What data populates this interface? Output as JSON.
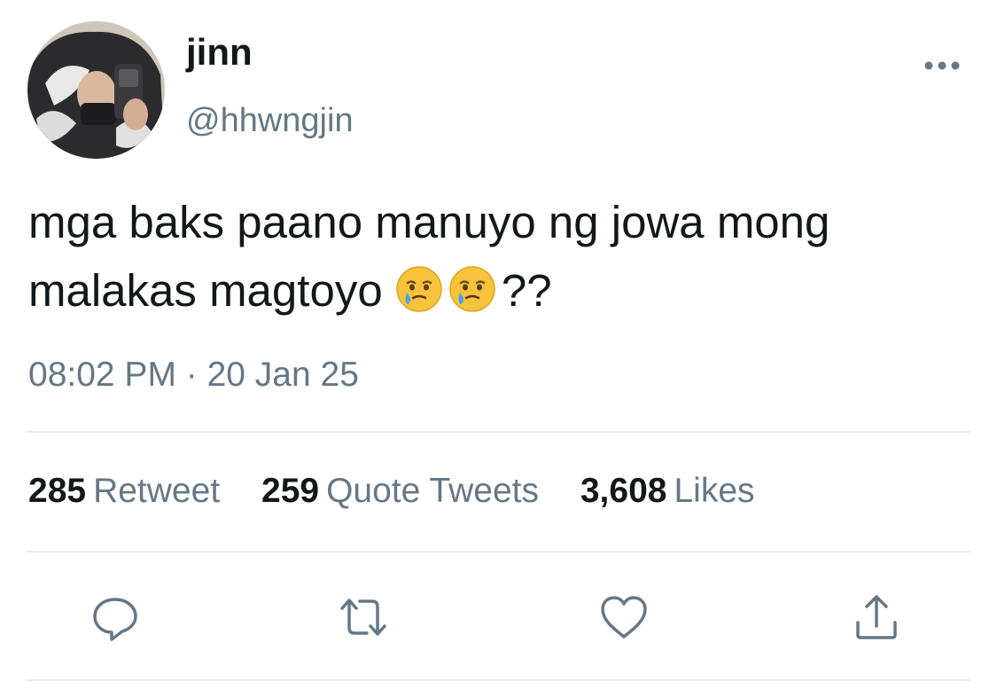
{
  "author": {
    "display_name": "jinn",
    "handle": "@hhwngjin"
  },
  "tweet": {
    "text_line1": "mga baks paano manuyo ng jowa mong",
    "text_line2": "malakas magtoyo",
    "text_suffix": "??",
    "emoji": [
      "face-holding-back-tears",
      "face-holding-back-tears"
    ],
    "timestamp": "08:02 PM · 20 Jan 25"
  },
  "stats": {
    "retweets": {
      "count": "285",
      "label": "Retweet"
    },
    "quotes": {
      "count": "259",
      "label": "Quote Tweets"
    },
    "likes": {
      "count": "3,608",
      "label": "Likes"
    }
  },
  "actions": [
    "reply-icon",
    "retweet-icon",
    "like-icon",
    "share-icon"
  ],
  "colors": {
    "text": "#14171a",
    "secondary": "#657786",
    "divider": "#e6ecf0",
    "icon": "#657786"
  }
}
